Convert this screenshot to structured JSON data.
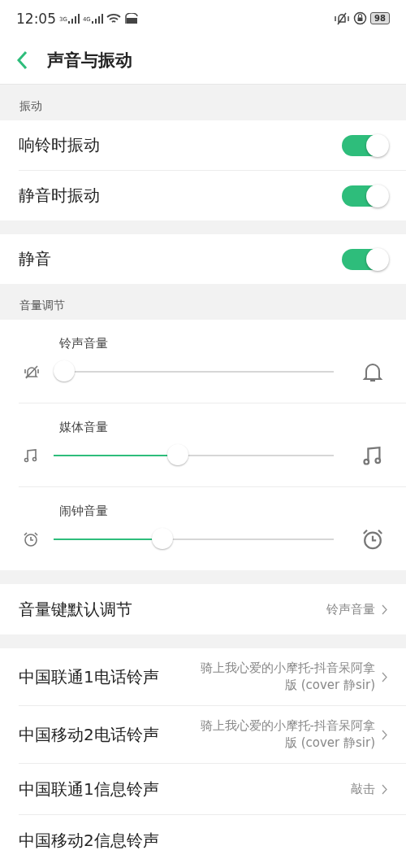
{
  "status_bar": {
    "time": "12:05",
    "signals": [
      "3G",
      "4G"
    ],
    "battery": "98"
  },
  "header": {
    "title": "声音与振动"
  },
  "sections": [
    {
      "kind": "toggles",
      "title": "振动",
      "rows": [
        {
          "label": "响铃时振动",
          "on": true
        },
        {
          "label": "静音时振动",
          "on": true
        }
      ]
    },
    {
      "kind": "toggles",
      "rows": [
        {
          "label": "静音",
          "on": true
        }
      ]
    },
    {
      "kind": "sliders",
      "title": "音量调节",
      "sliders": [
        {
          "label": "铃声音量",
          "level": 0.0
        },
        {
          "label": "媒体音量",
          "level": 0.44
        },
        {
          "label": "闹钟音量",
          "level": 0.38
        }
      ]
    },
    {
      "kind": "links",
      "rows": [
        {
          "label": "音量键默认调节",
          "value": "铃声音量"
        }
      ]
    },
    {
      "kind": "links",
      "rows": [
        {
          "label": "中国联通1电话铃声",
          "value": "骑上我心爱的小摩托-抖音呆阿拿版 (cover 静sir)"
        },
        {
          "label": "中国移动2电话铃声",
          "value": "骑上我心爱的小摩托-抖音呆阿拿版 (cover 静sir)"
        },
        {
          "label": "中国联通1信息铃声",
          "value": "敲击"
        },
        {
          "label": "中国移动2信息铃声"
        }
      ]
    }
  ]
}
